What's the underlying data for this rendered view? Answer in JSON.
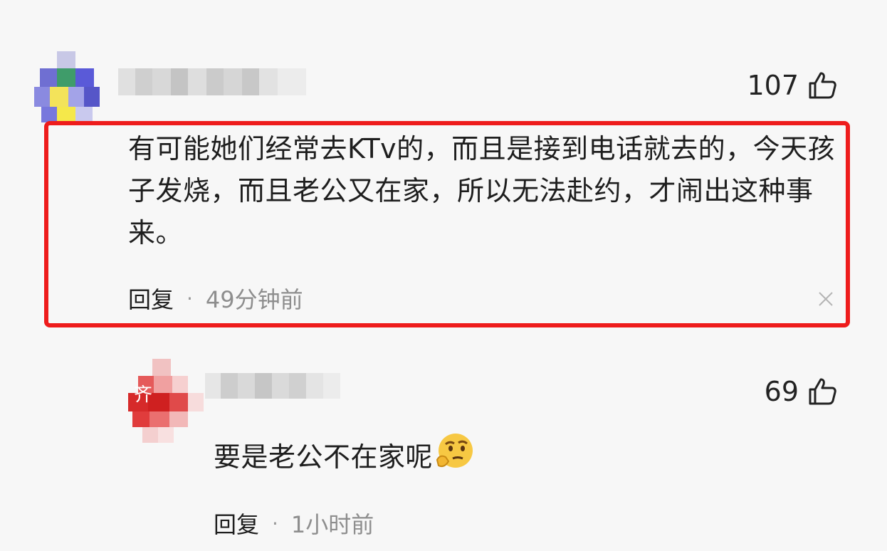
{
  "comments": [
    {
      "likes": "107",
      "text": "有可能她们经常去KTv的，而且是接到电话就去的，今天孩子发烧，而且老公又在家，所以无法赴约，才闹出这种事来。",
      "reply_label": "回复",
      "separator": "·",
      "time": "49分钟前",
      "highlighted": true,
      "highlight_color": "#ee1c1c"
    },
    {
      "likes": "69",
      "text": "要是老公不在家呢",
      "emoji": "thinking-face-emoji",
      "reply_label": "回复",
      "separator": "·",
      "time": "1小时前",
      "avatar_glyph": "齐"
    }
  ],
  "icons": {
    "like": "thumbs-up-icon",
    "close": "close-icon"
  }
}
